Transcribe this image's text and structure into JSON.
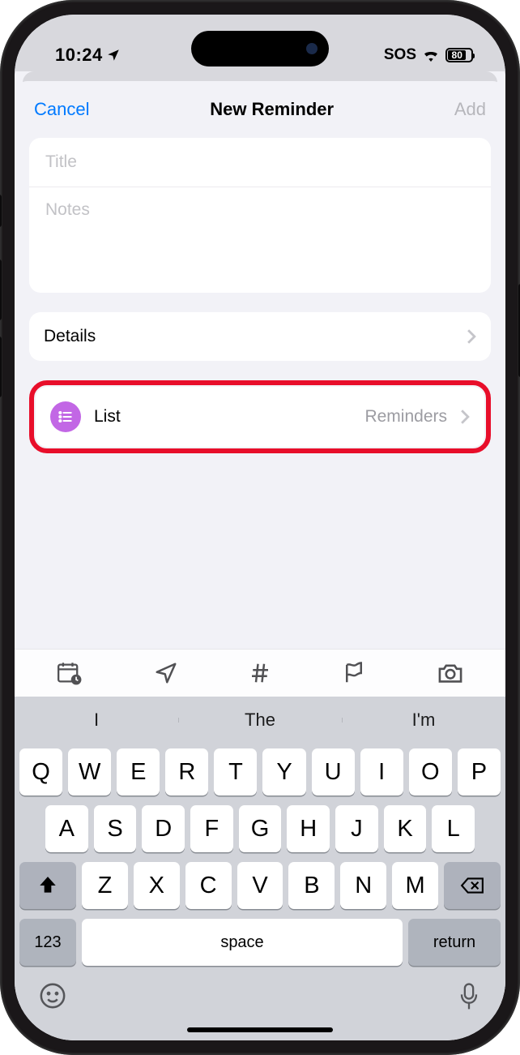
{
  "status_bar": {
    "time": "10:24",
    "sos": "SOS",
    "battery_pct": "80",
    "battery_width_pct": 80
  },
  "nav": {
    "cancel": "Cancel",
    "title": "New Reminder",
    "add": "Add"
  },
  "form": {
    "title_placeholder": "Title",
    "notes_placeholder": "Notes",
    "details_label": "Details",
    "list_label": "List",
    "list_value": "Reminders"
  },
  "keyboard": {
    "suggestions": [
      "I",
      "The",
      "I'm"
    ],
    "row1": [
      "Q",
      "W",
      "E",
      "R",
      "T",
      "Y",
      "U",
      "I",
      "O",
      "P"
    ],
    "row2": [
      "A",
      "S",
      "D",
      "F",
      "G",
      "H",
      "J",
      "K",
      "L"
    ],
    "row3": [
      "Z",
      "X",
      "C",
      "V",
      "B",
      "N",
      "M"
    ],
    "numbers_key": "123",
    "space_key": "space",
    "return_key": "return"
  }
}
